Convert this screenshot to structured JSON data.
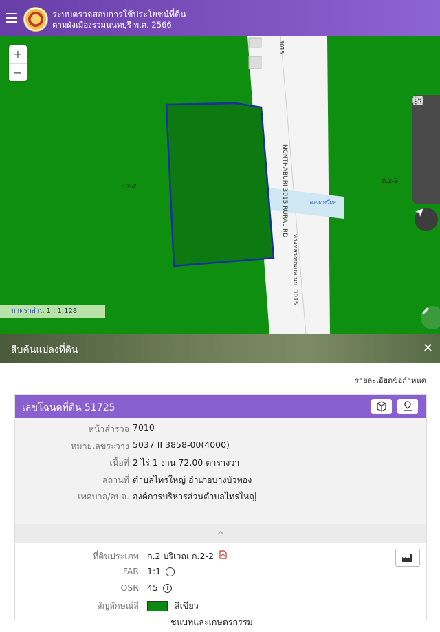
{
  "header": {
    "title_line1": "ระบบตรวจสอบการใช้ประโยชน์ที่ดิน",
    "title_line2": "ตามผังเมืองรวมนนทบุรี พ.ศ. 2566"
  },
  "map": {
    "zone_label_left": "ก.2-2",
    "zone_label_right": "ก.2-2",
    "road_label_en": "NONTHABURI 3015 RURAL RD",
    "road_label_th": "ทางหลวงชนบท นบ. 3015",
    "road_label_top": "3015",
    "canal_label": "คลองทวีผล",
    "scale_label": "มาตราส่วน",
    "scale_value": "1 : 1,128",
    "zoom_in": "+",
    "zoom_out": "−"
  },
  "search": {
    "title": "สืบค้นแปลงที่ดิน",
    "close": "✕",
    "details_link": "รายละเอียดข้อกำหนด"
  },
  "parcel": {
    "title": "เลขโฉนดที่ดิน 51725",
    "rows": [
      {
        "label": "หน้าสำรวจ",
        "value": "7010"
      },
      {
        "label": "หมายเลขระวาง",
        "value": "5037 II 3858-00(4000)"
      },
      {
        "label": "เนื้อที่",
        "value": "2 ไร่ 1 งาน 72.00 ตารางวา"
      },
      {
        "label": "สถานที่",
        "value": "ตำบลไทรใหญ่ อำเภอบางบัวทอง"
      },
      {
        "label": "เทศบาล/อบต.",
        "value": "องค์การบริหารส่วนตำบลไทรใหญ่"
      }
    ]
  },
  "land_use": {
    "type_label": "ที่ดินประเภท",
    "type_value": "ก.2 บริเวณ ก.2-2",
    "far_label": "FAR",
    "far_value": "1:1",
    "osr_label": "OSR",
    "osr_value": "45",
    "color_label": "สัญลักษณ์สี",
    "color_value": "สีเขียว",
    "color_desc": "ชนบทและเกษตรกรรม",
    "info_glyph": "i"
  },
  "colors": {
    "header": "#7b4fc2",
    "zone_green": "#0f8f10",
    "parcel_outline": "#1a2fa0"
  }
}
